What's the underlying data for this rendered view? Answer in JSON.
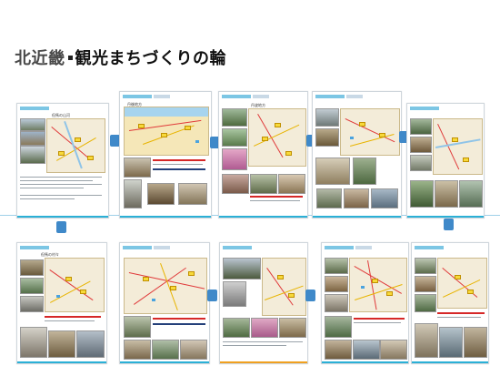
{
  "title": {
    "prefix": "北近畿",
    "main": "観光まちづくりの輪"
  },
  "pages": [
    {
      "label": "但馬の山河"
    },
    {
      "label": "丹後地方"
    },
    {
      "label": "丹波地方"
    },
    {
      "label": ""
    },
    {
      "label": ""
    },
    {
      "label": "但馬の村々"
    },
    {
      "label": ""
    },
    {
      "label": ""
    },
    {
      "label": ""
    },
    {
      "label": ""
    }
  ],
  "colors": {
    "accent_blue": "#3f89c9",
    "page_bar": "#2bb0d6",
    "page_bar_orange": "#f0a020"
  }
}
